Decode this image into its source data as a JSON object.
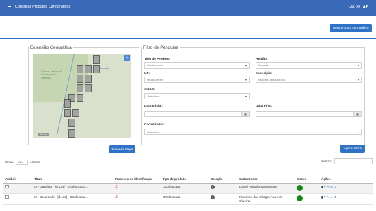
{
  "header": {
    "title": "Consultar Produtos Cartográficos",
    "user_label": "Olá, xx",
    "user_icon": "user-icon"
  },
  "toolbar": {
    "new_product_label": "Novo produto cartográfico"
  },
  "geo": {
    "legend": "Extensão Geográfica",
    "map_label": "Parque Nacional Cavernas do Peruaçu",
    "map_small_label": "Januária",
    "scale_label": "10 km",
    "expand_label": "Expandir Mapa"
  },
  "filter": {
    "legend": "Filtro de Pesquisa",
    "tipo_label": "Tipo de Produto:",
    "tipo_value": "Ortofotocarta",
    "regiao_label": "Região:",
    "regiao_value": "Sudeste",
    "uf_label": "UF:",
    "uf_value": "Minas Gerais",
    "municipio_label": "Município:",
    "municipio_value": "Escolha um Município",
    "status_label": "Status:",
    "status_value": "Selecione",
    "data_inicial_label": "Data Inicial:",
    "data_final_label": "Data Final:",
    "cadastrador_label": "Cadastrador:",
    "cadastrador_value": "Selecione",
    "apply_label": "Aplicar filtros"
  },
  "listing": {
    "show_label": "Show",
    "show_value": "10",
    "entries_label": "entries",
    "search_label": "Search:"
  },
  "table": {
    "headers": [
      "Atribuir",
      "Título",
      "Processo de identificação",
      "Tipo de produto",
      "Coleção",
      "Cadastrador",
      "Status",
      "Ações"
    ],
    "rows": [
      {
        "titulo": "UI - Januária - [id:134] - Ortofotocarta...",
        "tipo": "Ortofotocarta",
        "cadastrador": "Daniel Valadão Massonetto"
      },
      {
        "titulo": "UI - Itacarambi - [id:138] - Ortofotocar...",
        "tipo": "Ortofotocarta",
        "cadastrador": "Francisco das Chagas Alves de Oliveira"
      }
    ]
  },
  "colors": {
    "brand": "#3a6ab7",
    "button": "#2f73c9",
    "status_ok": "#148a14",
    "warning": "#d42a2a"
  }
}
